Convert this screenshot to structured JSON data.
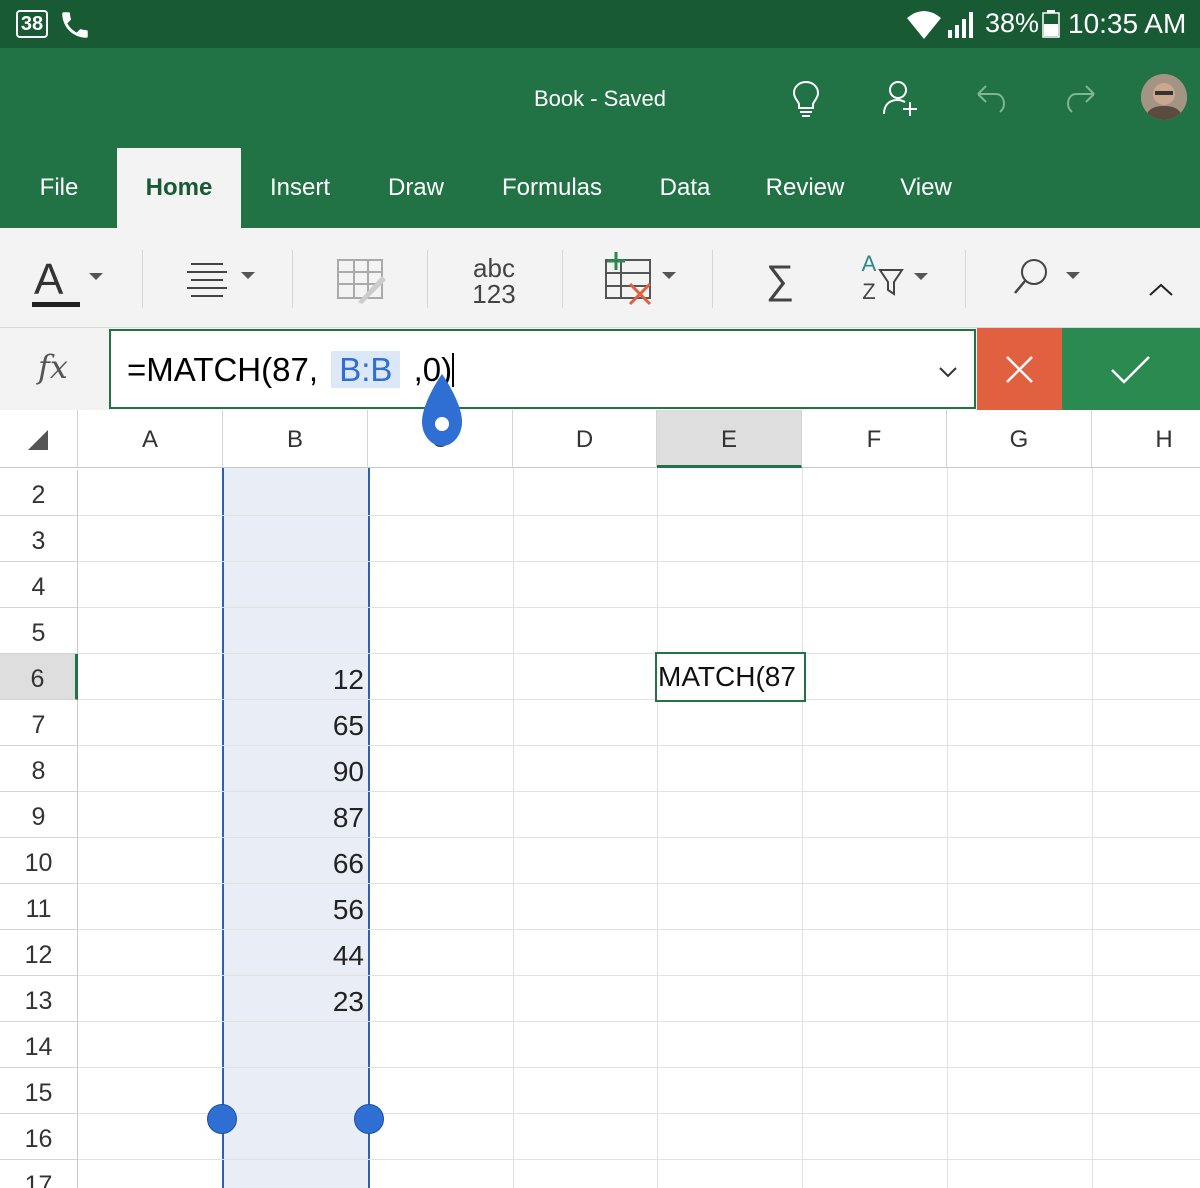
{
  "status_bar": {
    "notification_badge": "38",
    "battery_percent": "38%",
    "time": "10:35 AM"
  },
  "title_bar": {
    "document_title": "Book - Saved",
    "icons": [
      "lightbulb-icon",
      "share-person-icon",
      "undo-icon",
      "redo-icon",
      "avatar"
    ]
  },
  "tabs": [
    {
      "label": "File",
      "active": false
    },
    {
      "label": "Home",
      "active": true
    },
    {
      "label": "Insert",
      "active": false
    },
    {
      "label": "Draw",
      "active": false
    },
    {
      "label": "Formulas",
      "active": false
    },
    {
      "label": "Data",
      "active": false
    },
    {
      "label": "Review",
      "active": false
    },
    {
      "label": "View",
      "active": false
    }
  ],
  "ribbon": {
    "font_color_letter": "A",
    "number_format_top": "abc",
    "number_format_bottom": "123",
    "sort_label_top": "A",
    "sort_label_bottom": "Z",
    "sum_symbol": "∑"
  },
  "formula_bar": {
    "fx_label": "fx",
    "prefix": "=MATCH(87,",
    "reference": "B:B",
    "suffix": ",0)"
  },
  "sheet": {
    "columns": [
      "A",
      "B",
      "C",
      "D",
      "E",
      "F",
      "G",
      "H"
    ],
    "selected_column": "E",
    "rows": [
      "2",
      "3",
      "4",
      "5",
      "6",
      "7",
      "8",
      "9",
      "10",
      "11",
      "12",
      "13",
      "14",
      "15",
      "16",
      "17"
    ],
    "selected_row": "6",
    "column_b_values": [
      {
        "row": "6",
        "value": "12"
      },
      {
        "row": "7",
        "value": "65"
      },
      {
        "row": "8",
        "value": "90"
      },
      {
        "row": "9",
        "value": "87"
      },
      {
        "row": "10",
        "value": "66"
      },
      {
        "row": "11",
        "value": "56"
      },
      {
        "row": "12",
        "value": "44"
      },
      {
        "row": "13",
        "value": "23"
      }
    ],
    "active_cell_text": "MATCH(87"
  },
  "colors": {
    "status_bar": "#185a34",
    "excel_green": "#217346",
    "cancel_red": "#e1603f",
    "enter_green": "#2a8a4f",
    "reference_blue": "#2f6fd3",
    "selection_fill": "#e9eef6"
  }
}
